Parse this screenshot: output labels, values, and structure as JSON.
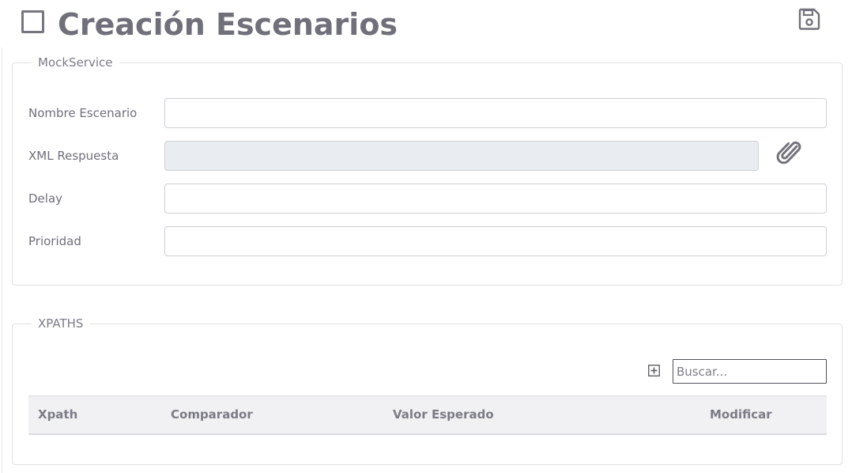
{
  "header": {
    "title": "Creación Escenarios",
    "save_icon": "save-icon",
    "checkbox_icon": "checkbox-empty-icon"
  },
  "mock_section": {
    "legend": "MockService",
    "fields": {
      "nombre": {
        "label": "Nombre Escenario",
        "value": ""
      },
      "xml": {
        "label": "XML Respuesta",
        "value": "",
        "disabled": true,
        "attach_icon": "paperclip-icon"
      },
      "delay": {
        "label": "Delay",
        "value": ""
      },
      "prioridad": {
        "label": "Prioridad",
        "value": ""
      }
    }
  },
  "xpaths_section": {
    "legend": "XPATHS",
    "add_icon": "plus-square-icon",
    "search": {
      "placeholder": "Buscar...",
      "value": ""
    },
    "table": {
      "columns": [
        "Xpath",
        "Comparador",
        "Valor Esperado",
        "Modificar"
      ],
      "rows": []
    }
  },
  "colors": {
    "text": "#7b7b86",
    "title": "#70707b",
    "border": "#e1e1e5",
    "disabled_bg": "#e9ecf1",
    "table_head_bg": "#f1f1f3"
  }
}
